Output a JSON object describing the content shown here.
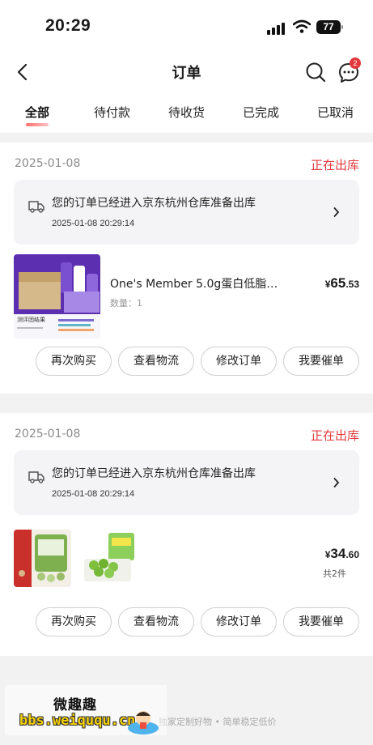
{
  "status_bar": {
    "time": "20:29",
    "battery": "77"
  },
  "header": {
    "title": "订单",
    "message_badge": "2"
  },
  "tabs": [
    {
      "label": "全部",
      "active": true
    },
    {
      "label": "待付款",
      "active": false
    },
    {
      "label": "待收货",
      "active": false
    },
    {
      "label": "已完成",
      "active": false
    },
    {
      "label": "已取消",
      "active": false
    }
  ],
  "orders": [
    {
      "date": "2025-01-08",
      "status": "正在出库",
      "logistics_text": "您的订单已经进入京东杭州仓库准备出库",
      "logistics_time": "2025-01-08 20:29:14",
      "product_name": "One's Member 5.0g蛋白低脂牛...",
      "quantity": "数量：1",
      "thumb_caption": "测评团结果",
      "price_currency": "¥",
      "price_int": "65",
      "price_dec": ".53",
      "buttons": [
        "再次购买",
        "查看物流",
        "修改订单",
        "我要催单"
      ]
    },
    {
      "date": "2025-01-08",
      "status": "正在出库",
      "logistics_text": "您的订单已经进入京东杭州仓库准备出库",
      "logistics_time": "2025-01-08 20:29:14",
      "price_currency": "¥",
      "price_int": "34",
      "price_dec": ".60",
      "item_count": "共2件",
      "buttons": [
        "再次购买",
        "查看物流",
        "修改订单",
        "我要催单"
      ]
    }
  ],
  "footer": {
    "slogan": "独家定制好物 • 简单稳定低价"
  },
  "watermark": {
    "title": "微趣趣",
    "url": "bbs.weiququ.cn"
  },
  "colors": {
    "accent": "#e4393c",
    "background": "#f2f2f2",
    "card": "#ffffff"
  },
  "icons": [
    "back-icon",
    "search-icon",
    "message-icon",
    "truck-icon",
    "chevron-right-icon"
  ]
}
